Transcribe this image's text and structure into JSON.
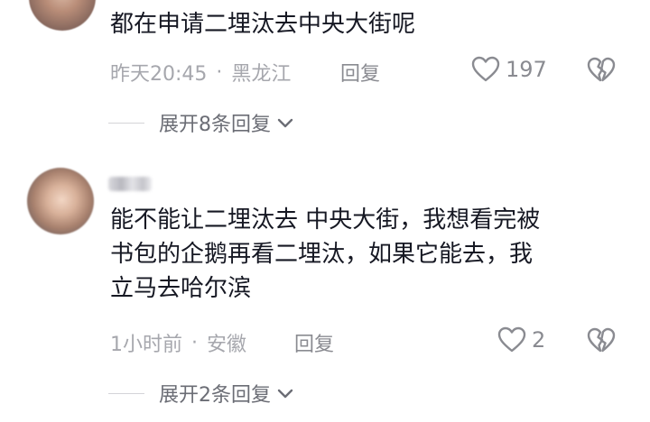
{
  "comments": [
    {
      "text": "都在申请二埋汰去中央大街呢",
      "time": "昨天20:45",
      "separator": "·",
      "location": "黑龙江",
      "reply_label": "回复",
      "like_count": "197",
      "expand_label": "展开8条回复"
    },
    {
      "text": "能不能让二埋汰去 中央大街，我想看完被\n书包的企鹅再看二埋汰，如果它能去，我\n立马去哈尔滨",
      "time": "1小时前",
      "separator": "·",
      "location": "安徽",
      "reply_label": "回复",
      "like_count": "2",
      "expand_label": "展开2条回复"
    }
  ],
  "icons": {
    "like": "heart-outline-icon",
    "dislike": "broken-heart-icon",
    "expand": "chevron-down-icon"
  },
  "colors": {
    "text_primary": "#161823",
    "text_meta": "#a6a7ad",
    "text_action": "#8a8b91"
  }
}
